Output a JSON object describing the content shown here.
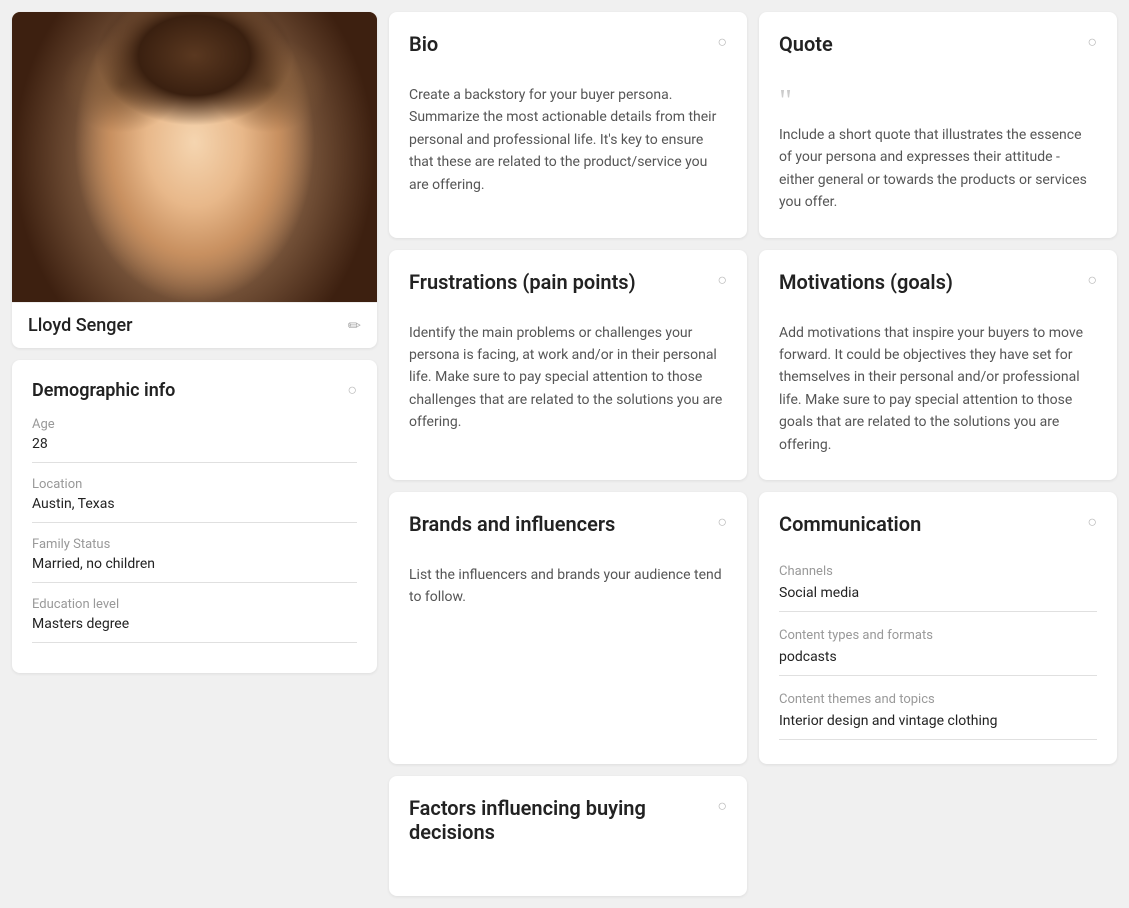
{
  "profile": {
    "name": "Lloyd Senger"
  },
  "demographic": {
    "title": "Demographic info",
    "fields": [
      {
        "label": "Age",
        "value": "28"
      },
      {
        "label": "Location",
        "value": "Austin, Texas"
      },
      {
        "label": "Family Status",
        "value": "Married, no children"
      },
      {
        "label": "Education level",
        "value": "Masters degree"
      }
    ]
  },
  "cards": {
    "bio": {
      "title": "Bio",
      "body": "Create a backstory for your buyer persona. Summarize the most actionable details from their personal and professional life. It's key to ensure that these are related to the product/service you are offering."
    },
    "quote": {
      "title": "Quote",
      "body": "Include a short quote that illustrates the essence of your persona and expresses their attitude - either general or towards the products or services you offer.",
      "quote_mark": "““"
    },
    "frustrations": {
      "title": "Frustrations (pain points)",
      "body": "Identify the main problems or challenges your persona is facing, at work and/or in their personal life. Make sure to pay special attention to those challenges that are related to the solutions you are offering."
    },
    "motivations": {
      "title": "Motivations (goals)",
      "body": "Add motivations that inspire your buyers to move forward. It could be objectives they have set for themselves in their personal and/or professional life. Make sure to pay special attention to those goals that are related to the solutions you are offering."
    },
    "brands": {
      "title": "Brands and influencers",
      "body": "List the influencers and brands your audience tend to follow."
    },
    "communication": {
      "title": "Communication",
      "fields": [
        {
          "label": "Channels",
          "value": "Social media"
        },
        {
          "label": "Content types and formats",
          "value": "podcasts"
        },
        {
          "label": "Content themes and topics",
          "value": "Interior design and vintage clothing"
        }
      ]
    },
    "factors": {
      "title": "Factors influencing buying decisions"
    }
  },
  "icons": {
    "hint": "○",
    "edit": "✏",
    "quote": "““"
  }
}
